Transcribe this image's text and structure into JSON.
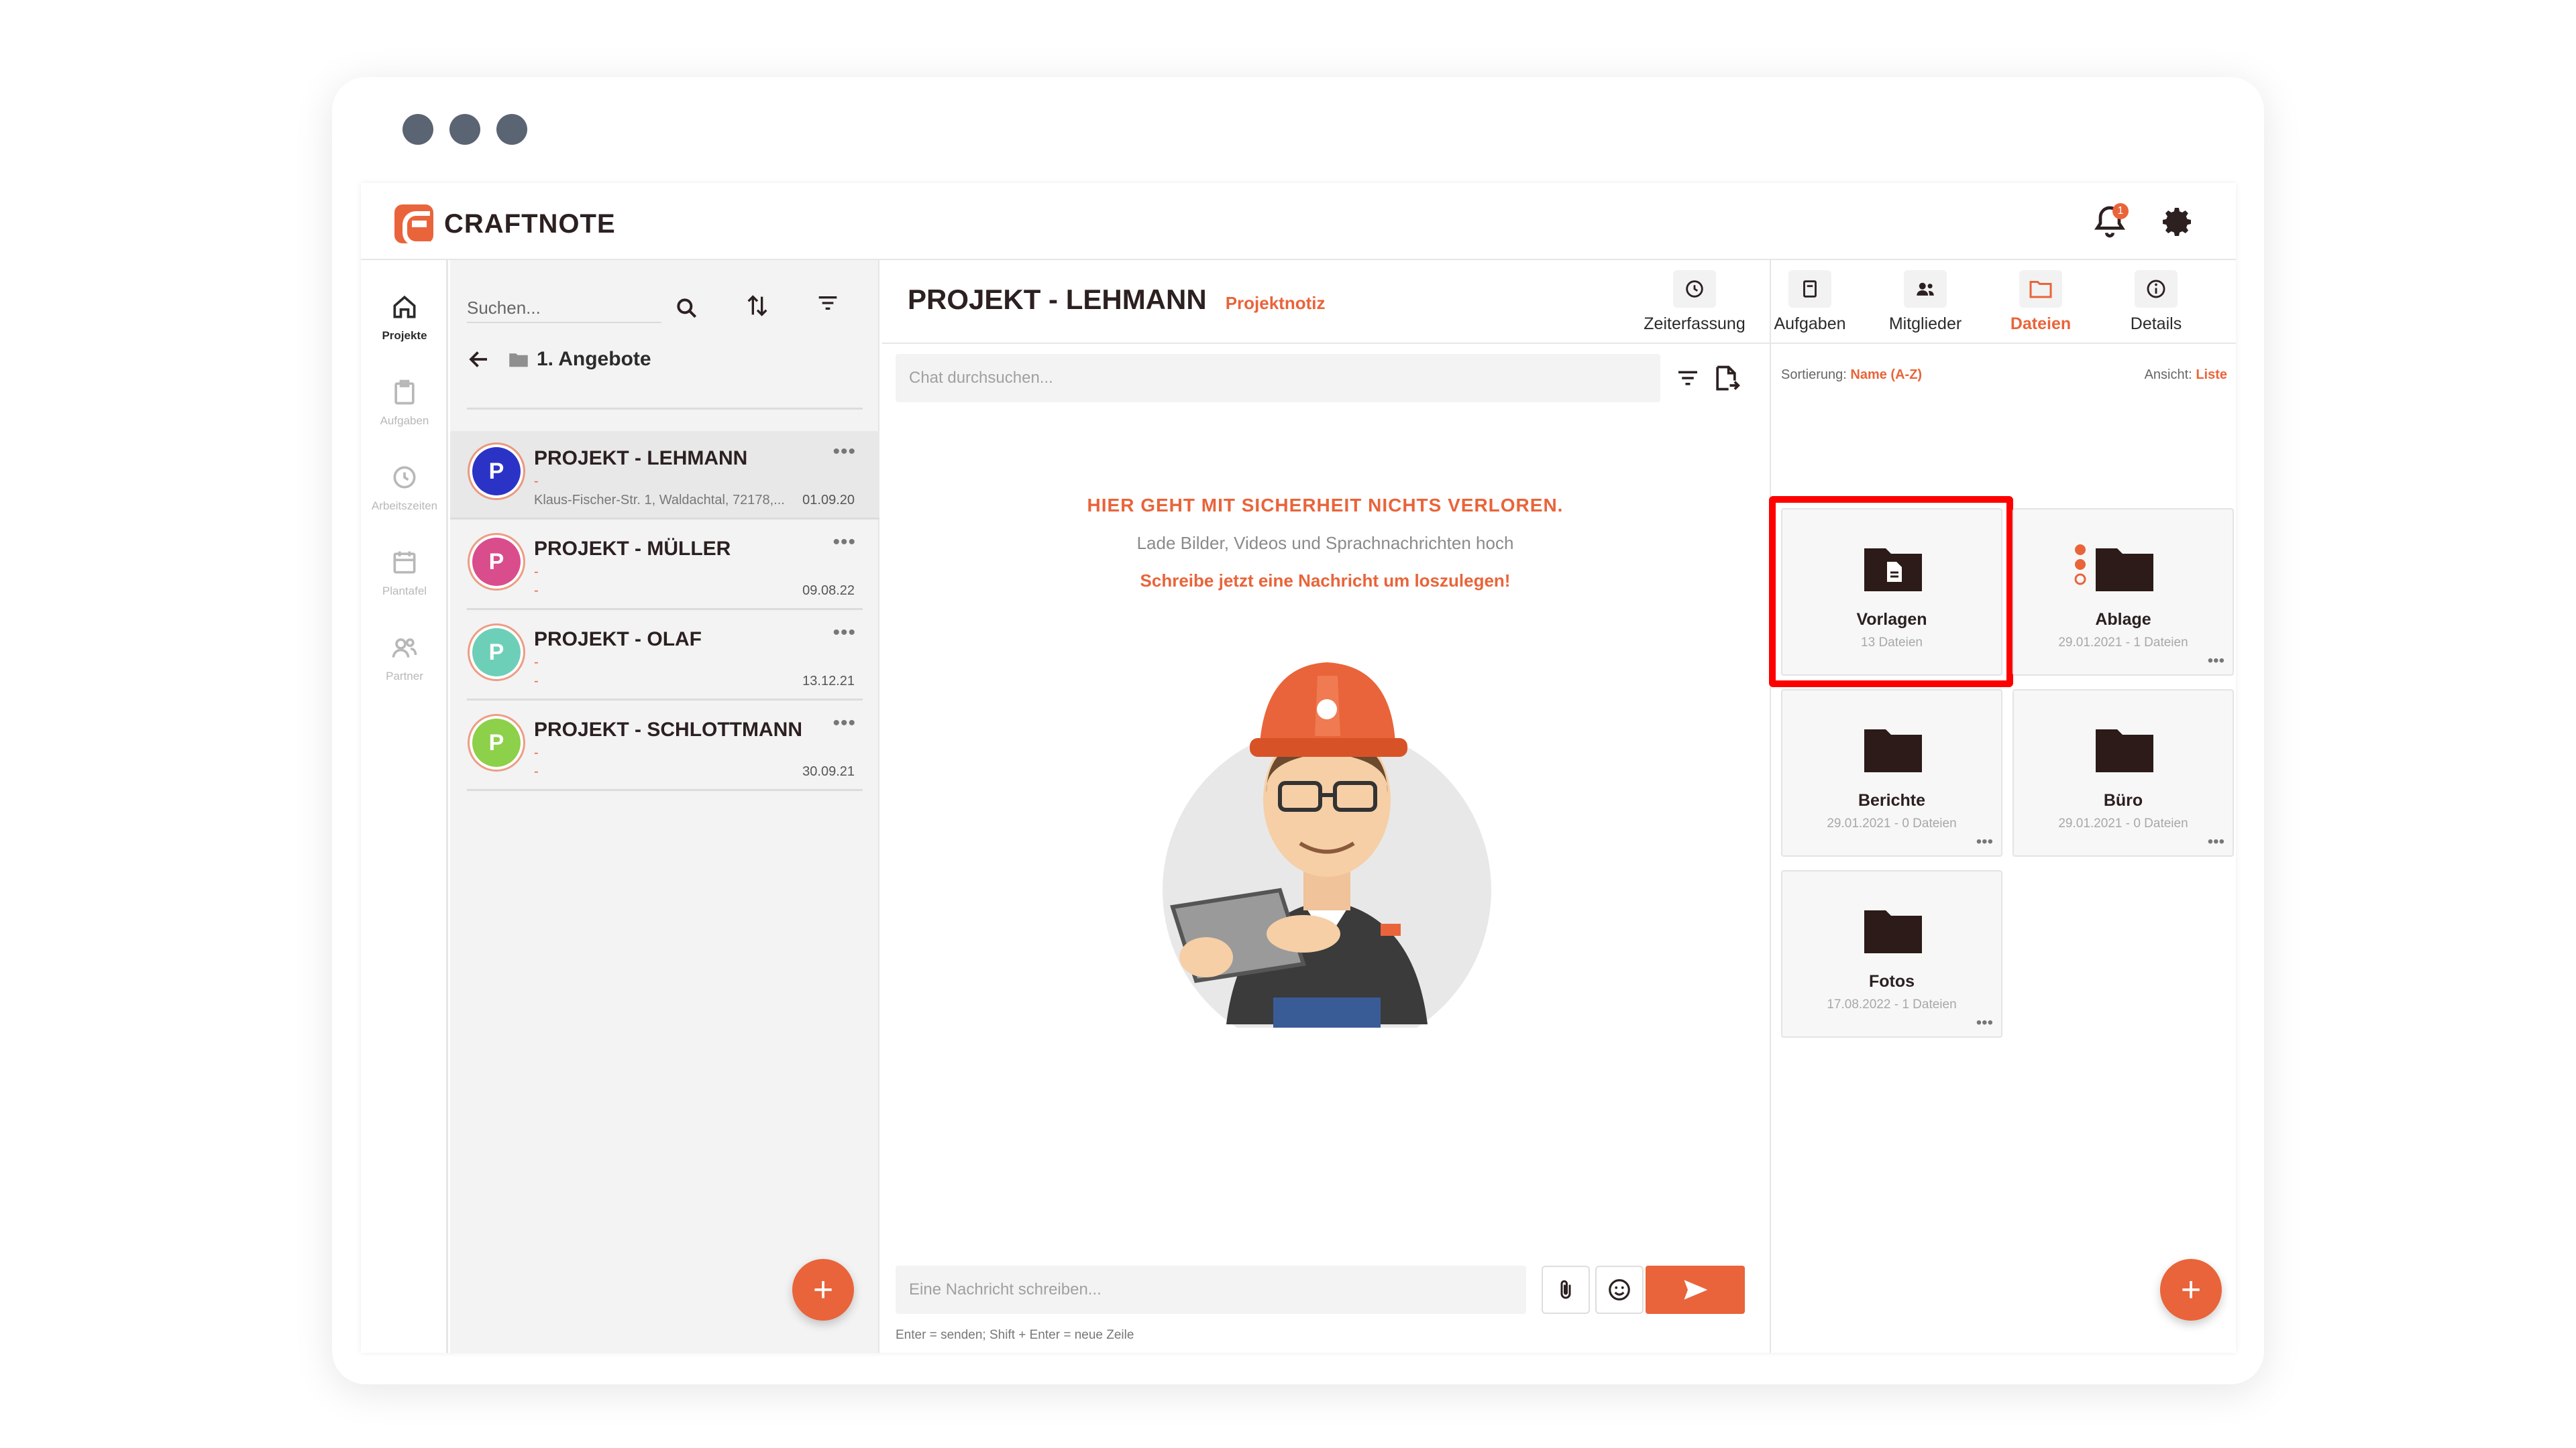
{
  "app": {
    "brand": "CRAFTNOTE",
    "notification_count": "1",
    "colors": {
      "accent": "#e9643a",
      "highlight": "#ff0000",
      "folder": "#2c1b18"
    }
  },
  "nav": {
    "items": [
      {
        "label": "Projekte",
        "icon": "home-icon",
        "active": true
      },
      {
        "label": "Aufgaben",
        "icon": "clipboard-icon"
      },
      {
        "label": "Arbeitszeiten",
        "icon": "clock-icon"
      },
      {
        "label": "Plantafel",
        "icon": "calendar-icon"
      },
      {
        "label": "Partner",
        "icon": "people-icon"
      }
    ]
  },
  "list": {
    "search_placeholder": "Suchen...",
    "breadcrumb": "1. Angebote",
    "projects": [
      {
        "title": "PROJEKT - LEHMANN",
        "sub": "-",
        "address": "Klaus-Fischer-Str. 1, Waldachtal, 72178,...",
        "date": "01.09.20",
        "initial": "P",
        "color": "#2b33c7"
      },
      {
        "title": "PROJEKT - MÜLLER",
        "sub": "-",
        "address": "-",
        "date": "09.08.22",
        "initial": "P",
        "color": "#d94d8c"
      },
      {
        "title": "PROJEKT - OLAF",
        "sub": "-",
        "address": "-",
        "date": "13.12.21",
        "initial": "P",
        "color": "#6ecfb8"
      },
      {
        "title": "PROJEKT - SCHLOTTMANN",
        "sub": "-",
        "address": "-",
        "date": "30.09.21",
        "initial": "P",
        "color": "#8dd04a"
      }
    ],
    "more": "•••",
    "add": "+"
  },
  "chat": {
    "project_title": "PROJEKT - LEHMANN",
    "project_subtitle": "Projektnotiz",
    "search_placeholder": "Chat durchsuchen...",
    "empty_title": "HIER GEHT MIT SICHERHEIT NICHTS VERLOREN.",
    "empty_sub": "Lade Bilder, Videos und Sprachnachrichten hoch",
    "empty_cta": "Schreibe jetzt eine Nachricht um loszulegen!",
    "message_placeholder": "Eine Nachricht schreiben...",
    "hint": "Enter = senden; Shift + Enter = neue Zeile"
  },
  "tabs": [
    {
      "label": "Zeiterfassung",
      "icon": "clock-icon"
    },
    {
      "label": "Aufgaben",
      "icon": "clipboard-icon"
    },
    {
      "label": "Mitglieder",
      "icon": "members-icon"
    },
    {
      "label": "Dateien",
      "icon": "folder-icon",
      "active": true
    },
    {
      "label": "Details",
      "icon": "info-icon"
    }
  ],
  "files": {
    "sort_label": "Sortierung:",
    "sort_value": "Name (A-Z)",
    "view_label": "Ansicht:",
    "view_value": "Liste",
    "folders": [
      {
        "name": "Vorlagen",
        "meta": "13 Dateien"
      },
      {
        "name": "Ablage",
        "meta": "29.01.2021 - 1 Dateien"
      },
      {
        "name": "Berichte",
        "meta": "29.01.2021 - 0 Dateien"
      },
      {
        "name": "Büro",
        "meta": "29.01.2021 - 0 Dateien"
      },
      {
        "name": "Fotos",
        "meta": "17.08.2022 - 1 Dateien"
      }
    ],
    "more": "•••",
    "add": "+"
  }
}
